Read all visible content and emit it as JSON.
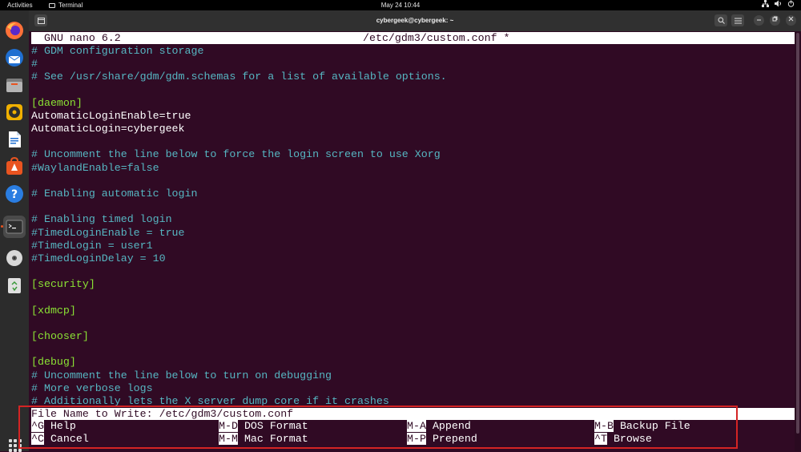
{
  "topbar": {
    "activities": "Activities",
    "app_name": "Terminal",
    "clock": "May 24  10:44"
  },
  "window": {
    "title": "cybergeek@cybergeek: ~"
  },
  "editor": {
    "version": "GNU nano 6.2",
    "filename": "/etc/gdm3/custom.conf *",
    "lines": [
      {
        "text": "# GDM configuration storage",
        "kind": "comment"
      },
      {
        "text": "#",
        "kind": "comment"
      },
      {
        "text": "# See /usr/share/gdm/gdm.schemas for a list of available options.",
        "kind": "comment"
      },
      {
        "text": "",
        "kind": "plain"
      },
      {
        "text": "[daemon]",
        "kind": "section"
      },
      {
        "text": "AutomaticLoginEnable=true",
        "kind": "plain"
      },
      {
        "text": "AutomaticLogin=cybergeek",
        "kind": "plain"
      },
      {
        "text": "",
        "kind": "plain"
      },
      {
        "text": "# Uncomment the line below to force the login screen to use Xorg",
        "kind": "comment"
      },
      {
        "text": "#WaylandEnable=false",
        "kind": "comment"
      },
      {
        "text": "",
        "kind": "plain"
      },
      {
        "text": "# Enabling automatic login",
        "kind": "comment"
      },
      {
        "text": "",
        "kind": "plain"
      },
      {
        "text": "# Enabling timed login",
        "kind": "comment"
      },
      {
        "text": "#TimedLoginEnable = true",
        "kind": "comment"
      },
      {
        "text": "#TimedLogin = user1",
        "kind": "comment"
      },
      {
        "text": "#TimedLoginDelay = 10",
        "kind": "comment"
      },
      {
        "text": "",
        "kind": "plain"
      },
      {
        "text": "[security]",
        "kind": "section"
      },
      {
        "text": "",
        "kind": "plain"
      },
      {
        "text": "[xdmcp]",
        "kind": "section"
      },
      {
        "text": "",
        "kind": "plain"
      },
      {
        "text": "[chooser]",
        "kind": "section"
      },
      {
        "text": "",
        "kind": "plain"
      },
      {
        "text": "[debug]",
        "kind": "section"
      },
      {
        "text": "# Uncomment the line below to turn on debugging",
        "kind": "comment"
      },
      {
        "text": "# More verbose logs",
        "kind": "comment"
      },
      {
        "text": "# Additionally lets the X server dump core if it crashes",
        "kind": "comment"
      }
    ],
    "prompt": "File Name to Write: /etc/gdm3/custom.conf",
    "shortcuts": [
      {
        "key": "^G",
        "label": "Help"
      },
      {
        "key": "M-D",
        "label": "DOS Format"
      },
      {
        "key": "M-A",
        "label": "Append"
      },
      {
        "key": "M-B",
        "label": "Backup File"
      },
      {
        "key": "^C",
        "label": "Cancel"
      },
      {
        "key": "M-M",
        "label": "Mac Format"
      },
      {
        "key": "M-P",
        "label": "Prepend"
      },
      {
        "key": "^T",
        "label": "Browse"
      }
    ]
  },
  "dock": [
    {
      "name": "firefox-icon"
    },
    {
      "name": "thunderbird-icon"
    },
    {
      "name": "files-icon"
    },
    {
      "name": "rhythmbox-icon"
    },
    {
      "name": "writer-icon"
    },
    {
      "name": "software-icon"
    },
    {
      "name": "help-icon"
    },
    {
      "name": "terminal-icon"
    },
    {
      "name": "dvd-icon"
    },
    {
      "name": "trash-icon"
    }
  ],
  "colors": {
    "terminal_bg": "#300a24",
    "comment": "#56b6c2",
    "section": "#8ae234",
    "highlight_box": "#d42424"
  }
}
